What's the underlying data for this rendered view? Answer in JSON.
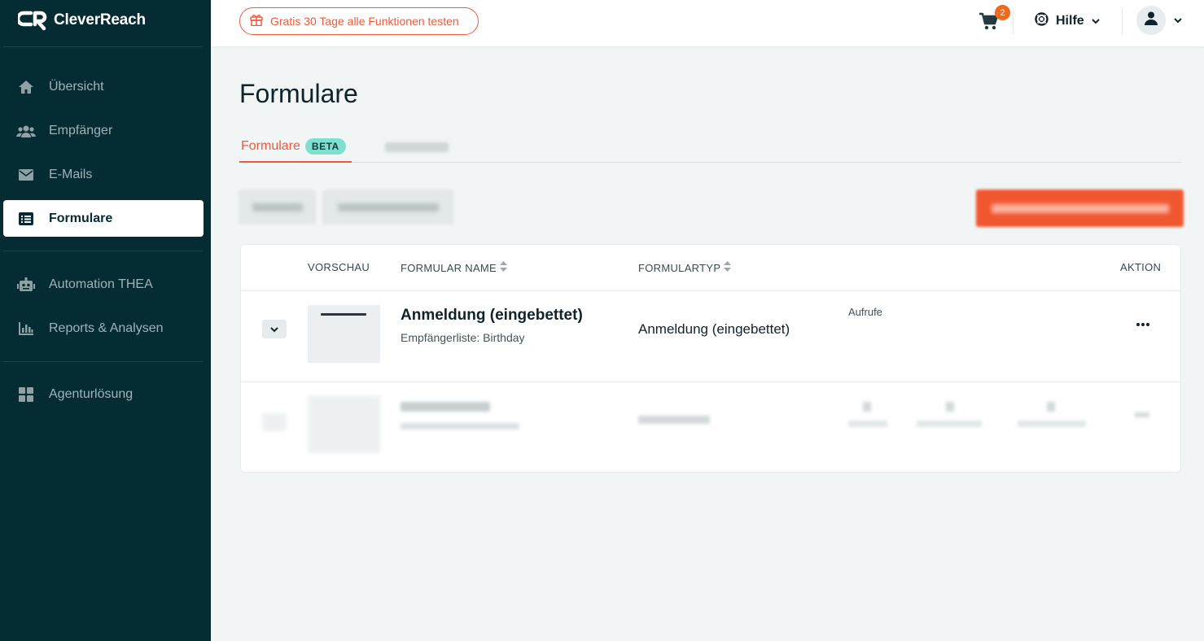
{
  "brand": {
    "name": "CleverReach"
  },
  "sidebar": {
    "items": [
      {
        "label": "Übersicht",
        "icon": "home-icon"
      },
      {
        "label": "Empfänger",
        "icon": "users-icon"
      },
      {
        "label": "E-Mails",
        "icon": "envelope-icon"
      },
      {
        "label": "Formulare",
        "icon": "list-icon",
        "active": true
      },
      {
        "label": "Automation THEA",
        "icon": "robot-icon"
      },
      {
        "label": "Reports & Analysen",
        "icon": "bar-chart-icon"
      },
      {
        "label": "Agenturlösung",
        "icon": "grid-icon"
      }
    ]
  },
  "topbar": {
    "trial_label": "Gratis 30 Tage alle Funktionen testen",
    "cart_count": "2",
    "help_label": "Hilfe"
  },
  "main": {
    "title": "Formulare",
    "tabs": [
      {
        "label": "Formulare",
        "badge": "BETA",
        "active": true
      }
    ]
  },
  "table": {
    "headers": {
      "preview": "VORSCHAU",
      "name": "FORMULAR NAME",
      "type": "FORMULARTYP",
      "action": "AKTION"
    },
    "rows": [
      {
        "name": "Anmeldung (eingebettet)",
        "subtitle": "Empfängerliste: Birthday",
        "type": "Anmeldung (eingebettet)",
        "stat_label": "Aufrufe"
      }
    ]
  },
  "colors": {
    "sidebar_bg": "#062c33",
    "accent": "#ef5a3c",
    "beta_badge": "#7fe0cf",
    "page_bg": "#f1f5f5"
  }
}
